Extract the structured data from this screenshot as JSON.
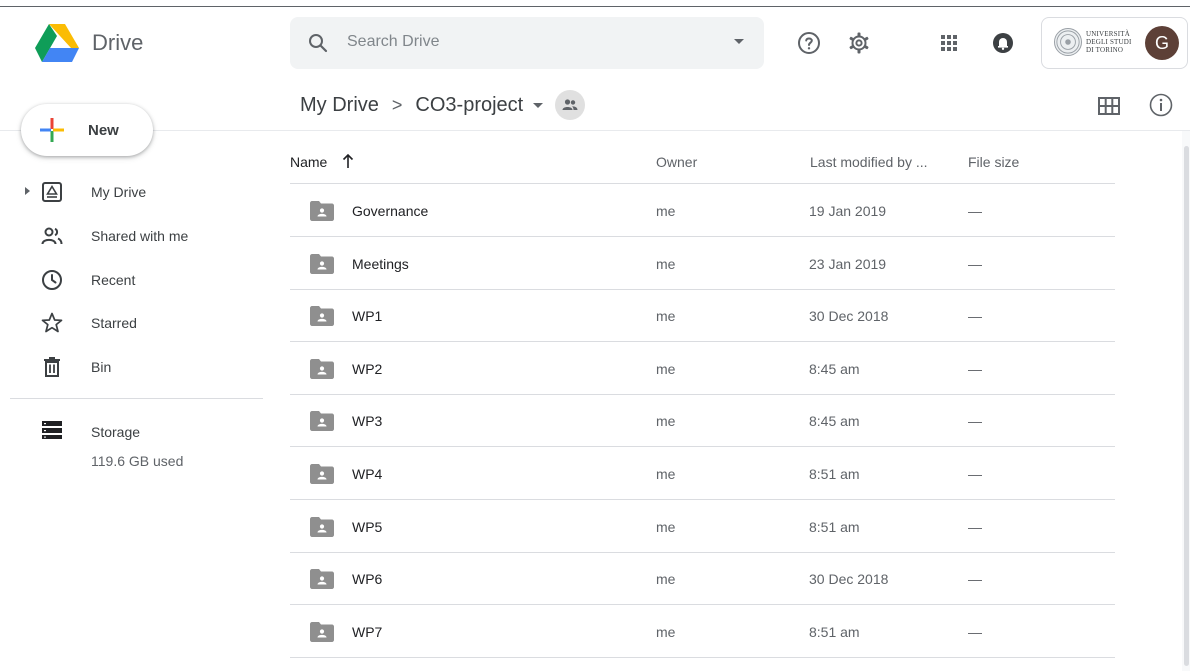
{
  "app": {
    "name": "Drive"
  },
  "search": {
    "placeholder": "Search Drive"
  },
  "account": {
    "org_line1": "UNIVERSITÀ",
    "org_line2": "DEGLI STUDI",
    "org_line3": "DI TORINO",
    "avatar_initial": "G",
    "avatar_color": "#5d4037"
  },
  "header_icons": [
    "help-icon",
    "settings-icon",
    "apps-icon",
    "notifications-icon"
  ],
  "breadcrumb": {
    "root": "My Drive",
    "separator": ">",
    "current": "CO3-project"
  },
  "sidebar": {
    "new_label": "New",
    "items": [
      {
        "label": "My Drive",
        "icon": "my-drive-icon"
      },
      {
        "label": "Shared with me",
        "icon": "shared-icon"
      },
      {
        "label": "Recent",
        "icon": "clock-icon"
      },
      {
        "label": "Starred",
        "icon": "star-icon"
      },
      {
        "label": "Bin",
        "icon": "bin-icon"
      }
    ],
    "storage": {
      "label": "Storage",
      "used": "119.6 GB used"
    }
  },
  "list": {
    "columns": {
      "name": "Name",
      "owner": "Owner",
      "modified": "Last modified by ...",
      "size": "File size"
    },
    "sort": "name-ascending",
    "rows": [
      {
        "name": "Governance",
        "owner": "me",
        "modified": "19 Jan 2019",
        "size": "—"
      },
      {
        "name": "Meetings",
        "owner": "me",
        "modified": "23 Jan 2019",
        "size": "—"
      },
      {
        "name": "WP1",
        "owner": "me",
        "modified": "30 Dec 2018",
        "size": "—"
      },
      {
        "name": "WP2",
        "owner": "me",
        "modified": "8:45 am",
        "size": "—"
      },
      {
        "name": "WP3",
        "owner": "me",
        "modified": "8:45 am",
        "size": "—"
      },
      {
        "name": "WP4",
        "owner": "me",
        "modified": "8:51 am",
        "size": "—"
      },
      {
        "name": "WP5",
        "owner": "me",
        "modified": "8:51 am",
        "size": "—"
      },
      {
        "name": "WP6",
        "owner": "me",
        "modified": "30 Dec 2018",
        "size": "—"
      },
      {
        "name": "WP7",
        "owner": "me",
        "modified": "8:51 am",
        "size": "—"
      }
    ]
  }
}
